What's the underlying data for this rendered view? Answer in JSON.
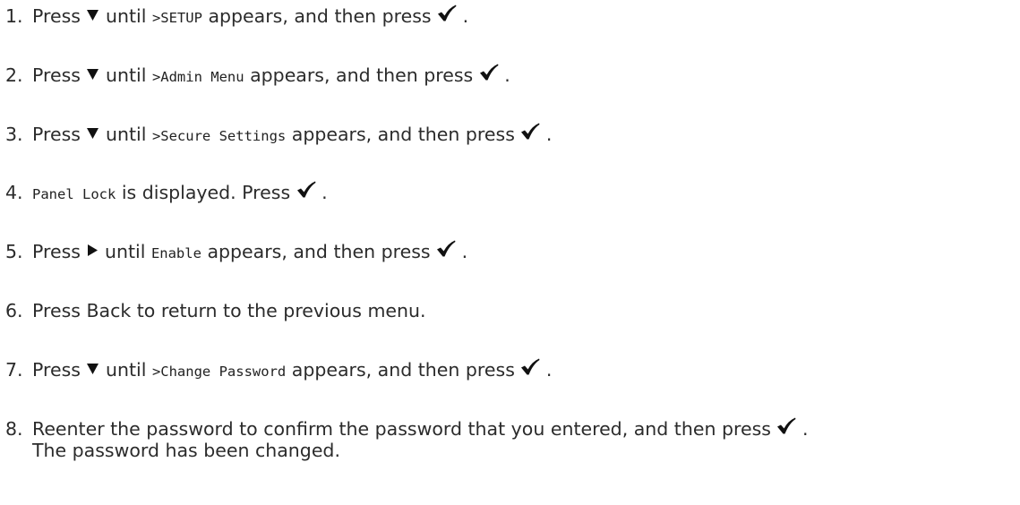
{
  "icons": {
    "down": "down-triangle-icon",
    "right": "right-triangle-icon",
    "check": "checkmark-icon"
  },
  "steps": [
    {
      "number": "1.",
      "parts": [
        {
          "text": "Press "
        },
        {
          "icon": "down"
        },
        {
          "text": " until "
        },
        {
          "code": ">SETUP"
        },
        {
          "text": " appears, and then press "
        },
        {
          "icon": "check"
        },
        {
          "text": " ."
        }
      ]
    },
    {
      "number": "2.",
      "parts": [
        {
          "text": "Press "
        },
        {
          "icon": "down"
        },
        {
          "text": " until "
        },
        {
          "code": ">Admin Menu"
        },
        {
          "text": " appears, and then press "
        },
        {
          "icon": "check"
        },
        {
          "text": " ."
        }
      ]
    },
    {
      "number": "3.",
      "parts": [
        {
          "text": "Press "
        },
        {
          "icon": "down"
        },
        {
          "text": " until "
        },
        {
          "code": ">Secure Settings"
        },
        {
          "text": " appears, and then press "
        },
        {
          "icon": "check"
        },
        {
          "text": " ."
        }
      ]
    },
    {
      "number": "4.",
      "parts": [
        {
          "code": "Panel Lock"
        },
        {
          "text": " is displayed. Press "
        },
        {
          "icon": "check"
        },
        {
          "text": " ."
        }
      ]
    },
    {
      "number": "5.",
      "parts": [
        {
          "text": "Press "
        },
        {
          "icon": "right"
        },
        {
          "text": " until "
        },
        {
          "code": "Enable"
        },
        {
          "text": " appears, and then press "
        },
        {
          "icon": "check"
        },
        {
          "text": " ."
        }
      ]
    },
    {
      "number": "6.",
      "parts": [
        {
          "text": "Press Back to return to the previous menu."
        }
      ]
    },
    {
      "number": "7.",
      "parts": [
        {
          "text": "Press "
        },
        {
          "icon": "down"
        },
        {
          "text": " until "
        },
        {
          "code": ">Change Password"
        },
        {
          "text": " appears, and then press "
        },
        {
          "icon": "check"
        },
        {
          "text": " ."
        }
      ]
    },
    {
      "number": "8.",
      "parts": [
        {
          "text": "Reenter the password to confirm the password that you entered, and then press "
        },
        {
          "icon": "check"
        },
        {
          "text": " ."
        }
      ],
      "continuation": "The password has been changed."
    }
  ]
}
